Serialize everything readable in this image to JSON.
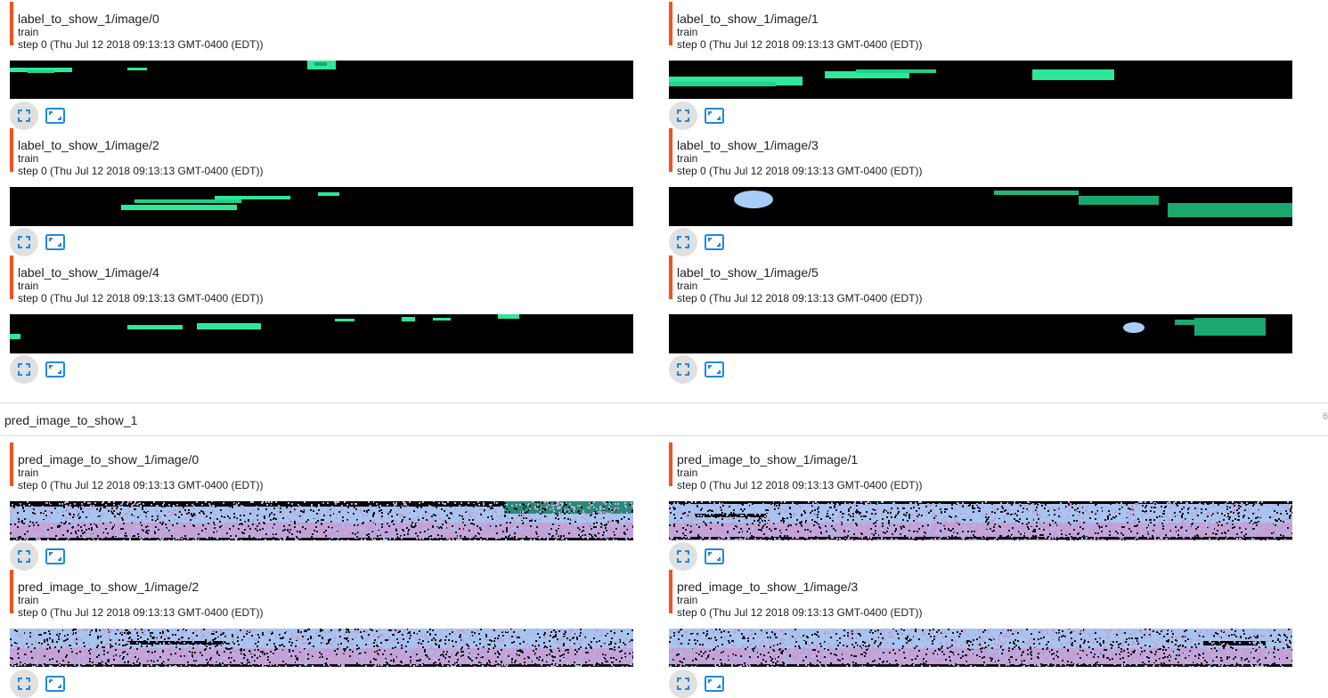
{
  "label_section": {
    "cards": [
      {
        "tag": "label_to_show_1/image/0",
        "run": "train",
        "step": "step 0 (Thu Jul 12 2018 09:13:13 GMT-0400 (EDT))"
      },
      {
        "tag": "label_to_show_1/image/1",
        "run": "train",
        "step": "step 0 (Thu Jul 12 2018 09:13:13 GMT-0400 (EDT))"
      },
      {
        "tag": "label_to_show_1/image/2",
        "run": "train",
        "step": "step 0 (Thu Jul 12 2018 09:13:13 GMT-0400 (EDT))"
      },
      {
        "tag": "label_to_show_1/image/3",
        "run": "train",
        "step": "step 0 (Thu Jul 12 2018 09:13:13 GMT-0400 (EDT))"
      },
      {
        "tag": "label_to_show_1/image/4",
        "run": "train",
        "step": "step 0 (Thu Jul 12 2018 09:13:13 GMT-0400 (EDT))"
      },
      {
        "tag": "label_to_show_1/image/5",
        "run": "train",
        "step": "step 0 (Thu Jul 12 2018 09:13:13 GMT-0400 (EDT))"
      }
    ]
  },
  "pred_section": {
    "title": "pred_image_to_show_1",
    "count": "6",
    "cards": [
      {
        "tag": "pred_image_to_show_1/image/0",
        "run": "train",
        "step": "step 0 (Thu Jul 12 2018 09:13:13 GMT-0400 (EDT))"
      },
      {
        "tag": "pred_image_to_show_1/image/1",
        "run": "train",
        "step": "step 0 (Thu Jul 12 2018 09:13:13 GMT-0400 (EDT))"
      },
      {
        "tag": "pred_image_to_show_1/image/2",
        "run": "train",
        "step": "step 0 (Thu Jul 12 2018 09:13:13 GMT-0400 (EDT))"
      },
      {
        "tag": "pred_image_to_show_1/image/3",
        "run": "train",
        "step": "step 0 (Thu Jul 12 2018 09:13:13 GMT-0400 (EDT))"
      }
    ]
  },
  "icons": {
    "expand": "fullscreen-icon",
    "fit": "aspect-ratio-icon"
  },
  "colors": {
    "accent": "#f4511e",
    "icon_blue": "#1e88e5",
    "label_green": "#2ee89a",
    "label_dark_green": "#1aa86e",
    "label_blue": "#a8cdf7",
    "pred_blue": "#a8c8f4",
    "pred_purple": "#c99ad0"
  }
}
